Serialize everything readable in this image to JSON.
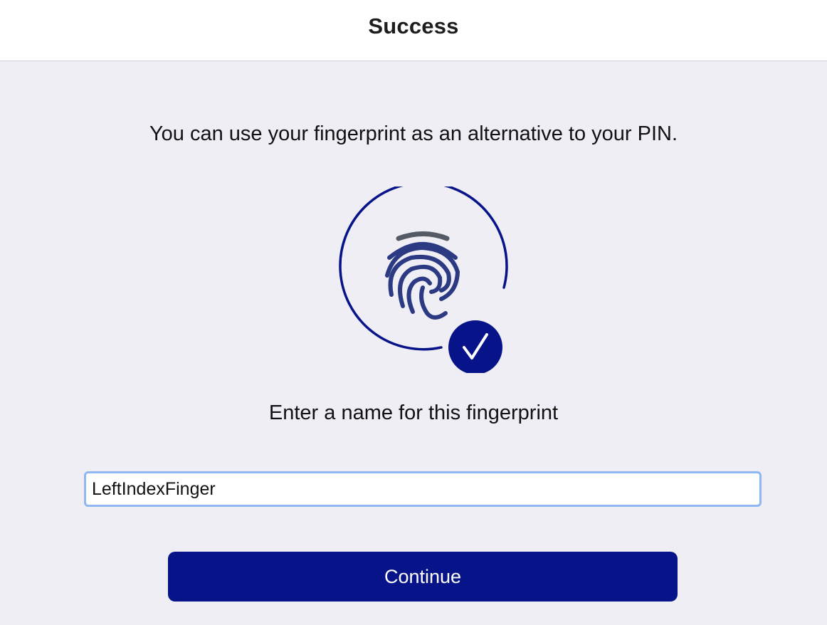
{
  "header": {
    "title": "Success"
  },
  "main": {
    "subtitle": "You can use your fingerprint as an alternative to your PIN.",
    "illustration": {
      "icon": "fingerprint-icon",
      "badge_icon": "checkmark-icon"
    },
    "prompt": "Enter a name for this fingerprint",
    "name_input": {
      "value": "LeftIndexFinger",
      "placeholder": ""
    },
    "continue_label": "Continue"
  },
  "colors": {
    "background": "#efeef5",
    "header_background": "#ffffff",
    "accent": "#071489",
    "fingerprint_top": "#555b66",
    "fingerprint": "#2c3a84",
    "input_focus_border": "#8fb7f4",
    "button_text": "#ffffff"
  }
}
